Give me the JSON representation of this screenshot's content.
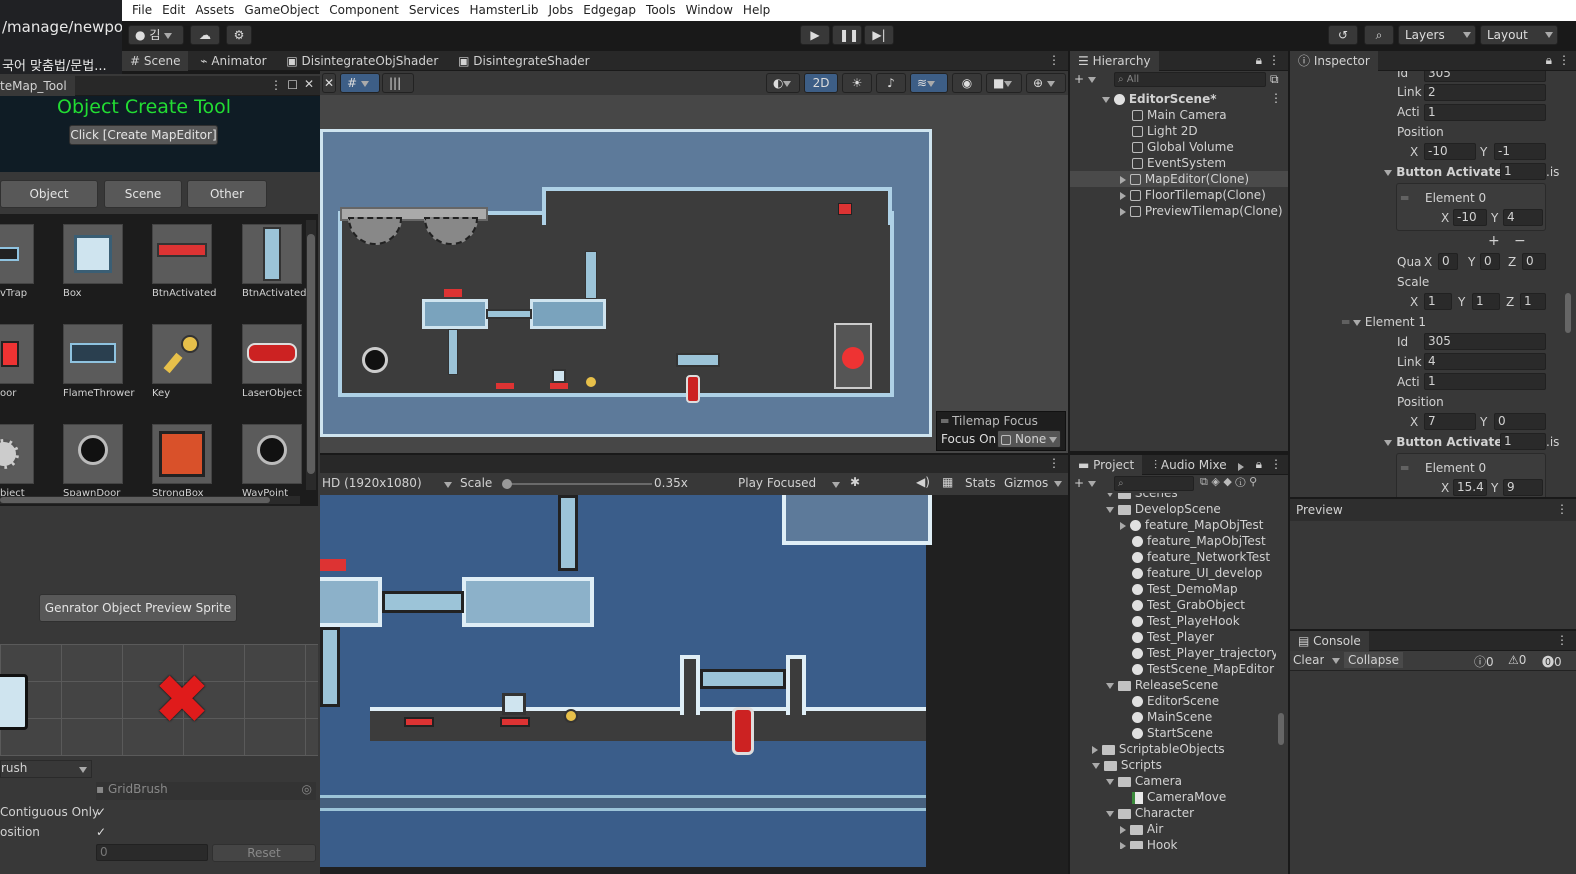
{
  "browser": {
    "url": "/manage/newpost/",
    "tab": "국어 맞춤법/문법..."
  },
  "menu": [
    "File",
    "Edit",
    "Assets",
    "GameObject",
    "Component",
    "Services",
    "HamsterLib",
    "Jobs",
    "Edgegap",
    "Tools",
    "Window",
    "Help"
  ],
  "toolbar": {
    "account": "김",
    "layers": "Layers",
    "layout": "Layout"
  },
  "scene_tabs": [
    "Scene",
    "Animator",
    "DisintegrateObjShader",
    "DisintegrateShader"
  ],
  "scene_toolbar": {
    "mode_2d": "2D"
  },
  "tilemap_focus": {
    "title": "Tilemap Focus",
    "focus_label": "Focus On",
    "focus_value": "None"
  },
  "tool_window": {
    "title": "teMap_Tool",
    "heading": "Object Create Tool",
    "create_button": "Click [Create MapEditor]",
    "tabs": [
      "Object",
      "Scene",
      "Other"
    ],
    "items": [
      {
        "label": "vTrap"
      },
      {
        "label": "Box"
      },
      {
        "label": "BtnActivated"
      },
      {
        "label": "BtnActivated"
      },
      {
        "label": "oor"
      },
      {
        "label": "FlameThrower"
      },
      {
        "label": "Key"
      },
      {
        "label": "LaserObject"
      },
      {
        "label": "bject"
      },
      {
        "label": "SpawnDoor"
      },
      {
        "label": "StrongBox"
      },
      {
        "label": "WayPoint"
      }
    ],
    "generate_button": "Genrator Object Preview Sprite",
    "brush_dropdown": "rush",
    "brush_name": "GridBrush",
    "contiguous_label": "Contiguous Only",
    "position_label": "osition",
    "value_field": "0",
    "reset_button": "Reset"
  },
  "game_toolbar": {
    "resolution": "HD (1920x1080)",
    "scale_label": "Scale",
    "scale_value": "0.35x",
    "scale_fraction": 0.02,
    "play_mode": "Play Focused",
    "stats": "Stats",
    "gizmos": "Gizmos"
  },
  "hierarchy": {
    "title": "Hierarchy",
    "search_placeholder": "All",
    "scene": "EditorScene*",
    "items": [
      "Main Camera",
      "Light 2D",
      "Global Volume",
      "EventSystem",
      "MapEditor(Clone)",
      "FloorTilemap(Clone)",
      "PreviewTilemap(Clone)"
    ]
  },
  "project": {
    "tabs": [
      "Project",
      "Audio Mixe"
    ],
    "tree": [
      {
        "label": "Scenes",
        "kind": "folder",
        "depth": 1
      },
      {
        "label": "DevelopScene",
        "kind": "folder",
        "depth": 1
      },
      {
        "label": "feature_MapObjTest",
        "kind": "scene",
        "depth": 2,
        "arrow": true
      },
      {
        "label": "feature_MapObjTest",
        "kind": "scene",
        "depth": 2
      },
      {
        "label": "feature_NetworkTest",
        "kind": "scene",
        "depth": 2
      },
      {
        "label": "feature_UI_develop",
        "kind": "scene",
        "depth": 2
      },
      {
        "label": "Test_DemoMap",
        "kind": "scene",
        "depth": 2
      },
      {
        "label": "Test_GrabObject",
        "kind": "scene",
        "depth": 2
      },
      {
        "label": "Test_PlayeHook",
        "kind": "scene",
        "depth": 2
      },
      {
        "label": "Test_Player",
        "kind": "scene",
        "depth": 2
      },
      {
        "label": "Test_Player_trajectory",
        "kind": "scene",
        "depth": 2
      },
      {
        "label": "TestScene_MapEditor",
        "kind": "scene",
        "depth": 2
      },
      {
        "label": "ReleaseScene",
        "kind": "folder",
        "depth": 1
      },
      {
        "label": "EditorScene",
        "kind": "scene",
        "depth": 2
      },
      {
        "label": "MainScene",
        "kind": "scene",
        "depth": 2
      },
      {
        "label": "StartScene",
        "kind": "scene",
        "depth": 2
      },
      {
        "label": "ScriptableObjects",
        "kind": "folder",
        "depth": 0
      },
      {
        "label": "Scripts",
        "kind": "folder",
        "depth": 0
      },
      {
        "label": "Camera",
        "kind": "folder",
        "depth": 1
      },
      {
        "label": "CameraMove",
        "kind": "script",
        "depth": 2
      },
      {
        "label": "Character",
        "kind": "folder",
        "depth": 1
      },
      {
        "label": "Air",
        "kind": "folder",
        "depth": 2
      },
      {
        "label": "Hook",
        "kind": "folder",
        "depth": 2
      }
    ]
  },
  "inspector": {
    "title": "Inspector",
    "id_label": "Id",
    "id_value": "305",
    "link_label": "Link",
    "link_value": "2",
    "acti_label": "Acti",
    "acti_value": "1",
    "position_label": "Position",
    "pos_x": "-10",
    "pos_y": "-1",
    "button_activate_label": "Button Activate P",
    "button_activate_count": "1",
    "is_label": ".is",
    "element0": "Element 0",
    "e0_x": "-10",
    "e0_y": "4",
    "plus": "+",
    "minus": "−",
    "qua_label": "Qua",
    "qx": "0",
    "qy": "0",
    "qz": "0",
    "scale_label": "Scale",
    "sx": "1",
    "sy": "1",
    "sz": "1",
    "element1": "Element 1",
    "e1_id": "305",
    "e1_link": "4",
    "e1_acti": "1",
    "e1_pos_x": "7",
    "e1_pos_y": "0",
    "e1_button_count": "1",
    "e1_element0": "Element 0",
    "e1_e0_x": "15.4",
    "e1_e0_y": "9"
  },
  "preview": {
    "title": "Preview"
  },
  "console": {
    "title": "Console",
    "clear": "Clear",
    "collapse": "Collapse",
    "info": "0",
    "warn": "0",
    "err": "0"
  },
  "axis_labels": {
    "x": "X",
    "y": "Y",
    "z": "Z"
  }
}
